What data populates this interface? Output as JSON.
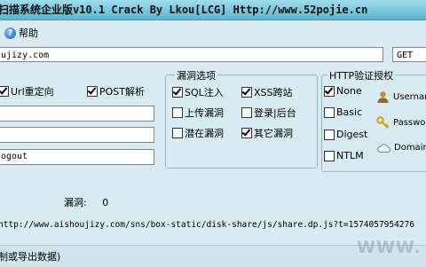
{
  "window": {
    "title": "扫描系统企业版v10.1   Crack  By  Lkou[LCG]   Http://www.52pojie.cn"
  },
  "menu": {
    "help_label": "帮助",
    "help_icon": "question-icon"
  },
  "target": {
    "url_value": "ujizy.com",
    "method_value": "GET"
  },
  "options": {
    "redirect_label": "Url重定向",
    "redirect_checked": true,
    "post_label": "POST解析",
    "post_checked": true
  },
  "fields": {
    "field1": "",
    "field2": "",
    "field3": "ogout"
  },
  "vuln_group": {
    "title": "漏洞选项",
    "items": [
      {
        "label": "SQL注入",
        "checked": true
      },
      {
        "label": "XSS跨站",
        "checked": true
      },
      {
        "label": "上传漏洞",
        "checked": false
      },
      {
        "label": "登录|后台",
        "checked": false
      },
      {
        "label": "潜在漏洞",
        "checked": false
      },
      {
        "label": "其它漏洞",
        "checked": true
      }
    ]
  },
  "auth_group": {
    "title": "HTTP验证授权",
    "methods": [
      {
        "label": "None",
        "checked": true
      },
      {
        "label": "Basic",
        "checked": false
      },
      {
        "label": "Digest",
        "checked": false
      },
      {
        "label": "NTLM",
        "checked": false
      }
    ],
    "fields": [
      {
        "label": "Usernam",
        "icon": "user-icon"
      },
      {
        "label": "Passwor",
        "icon": "key-icon"
      },
      {
        "label": "Domain",
        "icon": "cloud-icon"
      }
    ]
  },
  "stats": {
    "label": "漏洞:",
    "value": "0"
  },
  "current_url": "http://www.aishoujizy.com/sns/box-static/disk-share/js/share.dp.js?t=1574057954276",
  "status": {
    "text": "制或导出数据)"
  },
  "watermark": "WWW."
}
